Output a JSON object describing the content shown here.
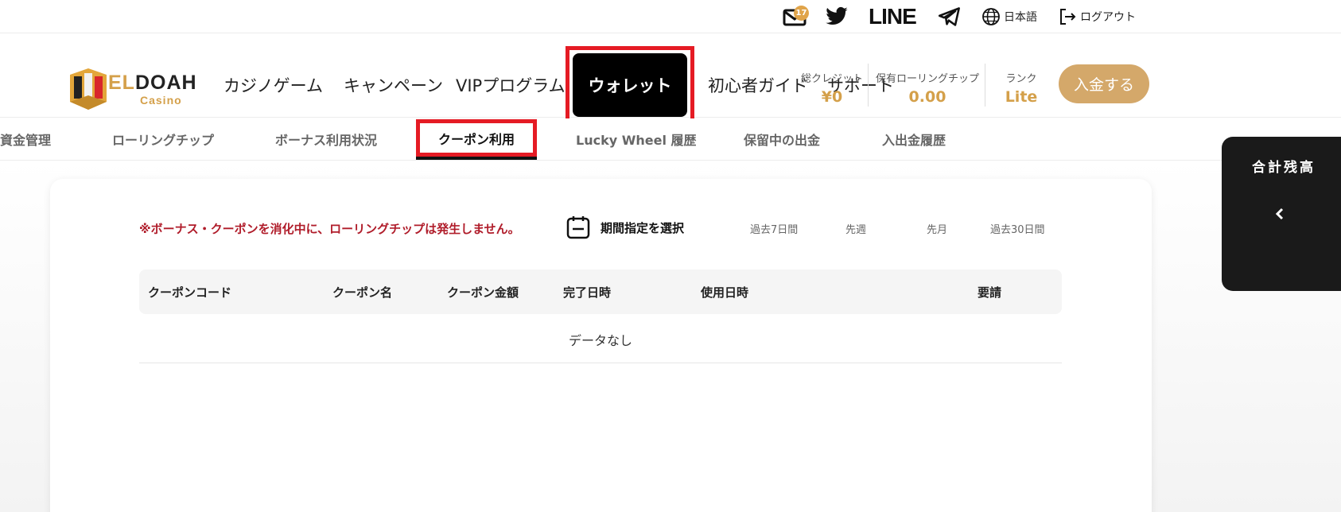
{
  "topbar": {
    "mail_badge": "17",
    "line_label": "LINE",
    "language": "日本語",
    "logout": "ログアウト"
  },
  "logo": {
    "el": "EL",
    "doah": "DOAH",
    "sub": "Casino"
  },
  "nav": {
    "items": [
      "カジノゲーム",
      "キャンペーン",
      "VIPプログラム",
      "ウォレット",
      "初心者ガイド",
      "サポート"
    ]
  },
  "stats": {
    "total_credit_label": "総クレジット",
    "total_credit_value": "¥0",
    "rolling_label": "保有ローリングチップ",
    "rolling_value": "0.00",
    "rank_label": "ランク",
    "rank_value": "Lite"
  },
  "deposit_label": "入金する",
  "subtabs": [
    "資金管理",
    "ローリングチップ",
    "ボーナス利用状況",
    "クーポン利用",
    "Lucky Wheel 履歴",
    "保留中の出金",
    "入出金履歴"
  ],
  "warning": "※ボーナス・クーポンを消化中に、ローリングチップは発生しません。",
  "period_label": "期間指定を選択",
  "quick_filters": [
    "過去7日間",
    "先週",
    "先月",
    "過去30日間"
  ],
  "table": {
    "headers": [
      "クーポンコード",
      "クーポン名",
      "クーポン金額",
      "完了日時",
      "使用日時",
      "要請"
    ],
    "empty": "データなし"
  },
  "side_panel": {
    "title": "合計残高"
  },
  "colors": {
    "gold": "#d4a04a",
    "highlight_red": "#e51b24",
    "warning_red": "#b01c2a"
  }
}
